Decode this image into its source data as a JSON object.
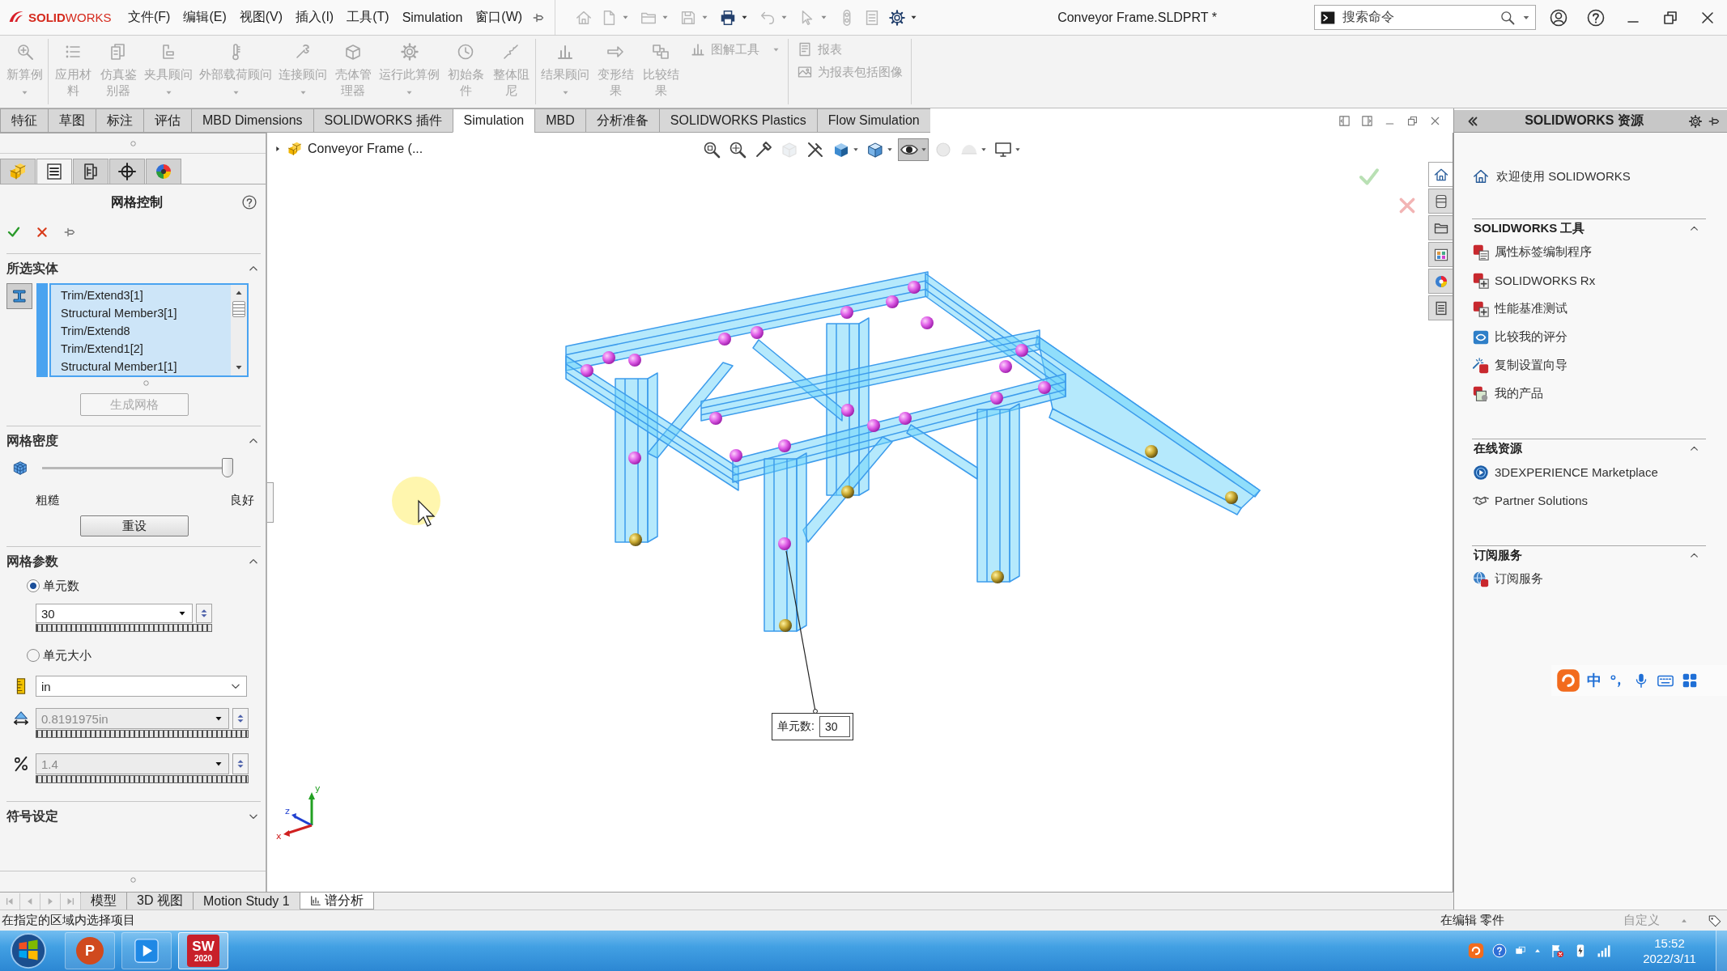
{
  "title_bar": {
    "logo": "**SOLID**WORKS",
    "menus": [
      "文件(F)",
      "编辑(E)",
      "视图(V)",
      "插入(I)",
      "工具(T)",
      "Simulation",
      "窗口(W)"
    ],
    "quick_access": [
      {
        "kind": "home",
        "menu": false,
        "disabled": true
      },
      {
        "kind": "new",
        "menu": true,
        "disabled": true
      },
      {
        "kind": "open",
        "menu": true,
        "disabled": true
      },
      {
        "kind": "save",
        "menu": true,
        "disabled": true
      },
      {
        "kind": "print",
        "menu": true,
        "disabled": false
      },
      {
        "kind": "undo",
        "menu": true,
        "disabled": true
      },
      {
        "kind": "select",
        "menu": true,
        "disabled": true
      },
      {
        "kind": "rebuild",
        "menu": false,
        "disabled": true
      },
      {
        "kind": "file-properties",
        "menu": false,
        "disabled": true
      },
      {
        "kind": "options",
        "menu": true,
        "disabled": false
      }
    ],
    "document_title": "Conveyor Frame.SLDPRT *",
    "search": {
      "placeholder": "搜索命令"
    }
  },
  "ribbon": {
    "groups": [
      {
        "commands": [
          {
            "label": "新算例",
            "kind": "large",
            "menu": true,
            "disabled": true
          }
        ]
      },
      {
        "commands": [
          {
            "label": "应用材料",
            "kind": "large",
            "menu": false,
            "disabled": true
          },
          {
            "label": "仿真鉴别器",
            "kind": "large",
            "menu": false,
            "disabled": true
          },
          {
            "label": "夹具顾问",
            "kind": "large",
            "menu": true,
            "disabled": true
          },
          {
            "label": "外部载荷顾问",
            "kind": "large",
            "menu": true,
            "disabled": true
          },
          {
            "label": "连接顾问",
            "kind": "large",
            "menu": true,
            "disabled": true
          },
          {
            "label": "壳体管理器",
            "kind": "large",
            "menu": false,
            "disabled": true
          },
          {
            "label": "运行此算例",
            "kind": "large",
            "menu": true,
            "disabled": true
          },
          {
            "label": "初始条件",
            "kind": "large",
            "menu": false,
            "disabled": true
          },
          {
            "label": "整体阻尼",
            "kind": "large",
            "menu": false,
            "disabled": true
          }
        ]
      },
      {
        "commands": [
          {
            "label": "结果顾问",
            "kind": "large",
            "menu": true,
            "disabled": true
          },
          {
            "label": "变形结果",
            "kind": "large",
            "menu": false,
            "disabled": true
          },
          {
            "label": "比较结果",
            "kind": "large",
            "menu": false,
            "disabled": true
          },
          {
            "label": "图解工具",
            "kind": "small",
            "menu": true,
            "disabled": true
          }
        ]
      },
      {
        "commands": [
          {
            "label": "报表",
            "kind": "small",
            "menu": false,
            "disabled": true
          },
          {
            "label": "为报表包括图像",
            "kind": "small",
            "menu": false,
            "disabled": true
          }
        ]
      }
    ]
  },
  "tabs": [
    {
      "label": "特征",
      "selected": false
    },
    {
      "label": "草图",
      "selected": false
    },
    {
      "label": "标注",
      "selected": false
    },
    {
      "label": "评估",
      "selected": false
    },
    {
      "label": "MBD Dimensions",
      "selected": false
    },
    {
      "label": "SOLIDWORKS 插件",
      "selected": false
    },
    {
      "label": "Simulation",
      "selected": true
    },
    {
      "label": "MBD",
      "selected": false
    },
    {
      "label": "分析准备",
      "selected": false
    },
    {
      "label": "SOLIDWORKS Plastics",
      "selected": false
    },
    {
      "label": "Flow Simulation",
      "selected": false
    }
  ],
  "property_manager": {
    "panel_tabs": [
      {
        "kind": "feature-tree",
        "selected": false
      },
      {
        "kind": "property",
        "selected": true
      },
      {
        "kind": "configuration",
        "selected": false
      },
      {
        "kind": "dimxpert",
        "selected": false
      },
      {
        "kind": "display",
        "selected": false
      }
    ],
    "title": "网格控制",
    "sections": [
      {
        "kind": "selection",
        "title": "所选实体",
        "expanded": true,
        "active": true,
        "items": [
          "Trim/Extend3[1]",
          "Structural Member3[1]",
          "Trim/Extend8",
          "Trim/Extend1[2]",
          "Structural Member1[1]"
        ],
        "button": {
          "label": "生成网格",
          "disabled": true
        }
      },
      {
        "kind": "density",
        "title": "网格密度",
        "expanded": true,
        "level": 1,
        "min_label": "粗糙",
        "max_label": "良好",
        "button": {
          "label": "重设",
          "disabled": false
        }
      },
      {
        "kind": "parameters",
        "title": "网格参数",
        "expanded": true,
        "count_option": {
          "label": "单元数",
          "selected": true
        },
        "count_field": {
          "value": "30"
        },
        "size_option": {
          "label": "单元大小",
          "selected": false
        },
        "unit_field": {
          "value": "in"
        },
        "size_field": {
          "value": "0.8191975in",
          "disabled": true
        },
        "ratio_field": {
          "value": "1.4",
          "disabled": true
        }
      },
      {
        "kind": "symbol",
        "title": "符号设定",
        "expanded": false
      }
    ]
  },
  "viewport": {
    "breadcrumb": "Conveyor Frame (...",
    "heads_up_toolbar": [
      {
        "kind": "zoom-fit",
        "menu": false,
        "pressed": false,
        "disabled": false
      },
      {
        "kind": "zoom-area",
        "menu": false,
        "pressed": false,
        "disabled": false
      },
      {
        "kind": "previous-view",
        "menu": false,
        "pressed": false,
        "disabled": false
      },
      {
        "kind": "section-view",
        "menu": false,
        "pressed": false,
        "disabled": true
      },
      {
        "kind": "dynamic-annotation",
        "menu": false,
        "pressed": false,
        "disabled": false
      },
      {
        "kind": "view-orientation",
        "menu": true,
        "pressed": false,
        "disabled": false
      },
      {
        "kind": "display-style",
        "menu": true,
        "pressed": false,
        "disabled": false
      },
      {
        "kind": "hide-show",
        "menu": true,
        "pressed": true,
        "disabled": false
      },
      {
        "kind": "edit-appearance",
        "menu": false,
        "pressed": false,
        "disabled": true
      },
      {
        "kind": "apply-scene",
        "menu": true,
        "pressed": false,
        "disabled": true
      },
      {
        "kind": "view-settings",
        "menu": true,
        "pressed": false,
        "disabled": false
      }
    ],
    "callout": {
      "label": "单元数:",
      "value": "30"
    },
    "triad": [
      {
        "label": "y",
        "color": "#22a022"
      },
      {
        "label": "z",
        "color": "#2040d0"
      },
      {
        "label": "x",
        "color": "#d02020"
      }
    ]
  },
  "task_pane": {
    "tabs": [
      {
        "kind": "home",
        "selected": true
      },
      {
        "kind": "library",
        "selected": false
      },
      {
        "kind": "explorer",
        "selected": false
      },
      {
        "kind": "view-palette",
        "selected": false
      },
      {
        "kind": "appearance",
        "selected": false
      },
      {
        "kind": "properties",
        "selected": false
      }
    ],
    "title": "SOLIDWORKS 资源",
    "welcome": "欢迎使用 SOLIDWORKS",
    "groups": [
      {
        "title": "SOLIDWORKS 工具",
        "expanded": true,
        "items": [
          {
            "label": "属性标签编制程序",
            "kind": "sw-tag"
          },
          {
            "label": "SOLIDWORKS Rx",
            "kind": "sw-rx"
          },
          {
            "label": "性能基准测试",
            "kind": "sw-rx"
          },
          {
            "label": "比较我的评分",
            "kind": "compare"
          },
          {
            "label": "复制设置向导",
            "kind": "wizard"
          },
          {
            "label": "我的产品",
            "kind": "product"
          }
        ]
      },
      {
        "title": "在线资源",
        "expanded": true,
        "items": [
          {
            "label": "3DEXPERIENCE Marketplace",
            "kind": "globe"
          },
          {
            "label": "Partner Solutions",
            "kind": "handshake"
          }
        ]
      },
      {
        "title": "订阅服务",
        "expanded": true,
        "items": [
          {
            "label": "订阅服务",
            "kind": "sw-globe"
          }
        ]
      }
    ]
  },
  "ime_toolbar": {
    "mode": "中"
  },
  "bottom_tabs": [
    {
      "label": "模型",
      "kind": "plain",
      "selected": false
    },
    {
      "label": "3D 视图",
      "kind": "plain",
      "selected": false
    },
    {
      "label": "Motion Study 1",
      "kind": "plain",
      "selected": false
    },
    {
      "label": "谱分析",
      "kind": "study",
      "selected": true
    }
  ],
  "status_bar": {
    "message": "在指定的区域内选择项目",
    "mode": "在编辑 零件",
    "units": {
      "label": "自定义",
      "disabled": true
    }
  },
  "taskbar": {
    "apps": [
      {
        "kind": "powerpoint",
        "glyph": "P",
        "active": false
      },
      {
        "kind": "media",
        "active": false
      },
      {
        "kind": "solidworks",
        "glyph": "SW",
        "badge": "2020",
        "active": true
      }
    ],
    "clock": {
      "time": "15:52",
      "date": "2022/3/11"
    }
  }
}
